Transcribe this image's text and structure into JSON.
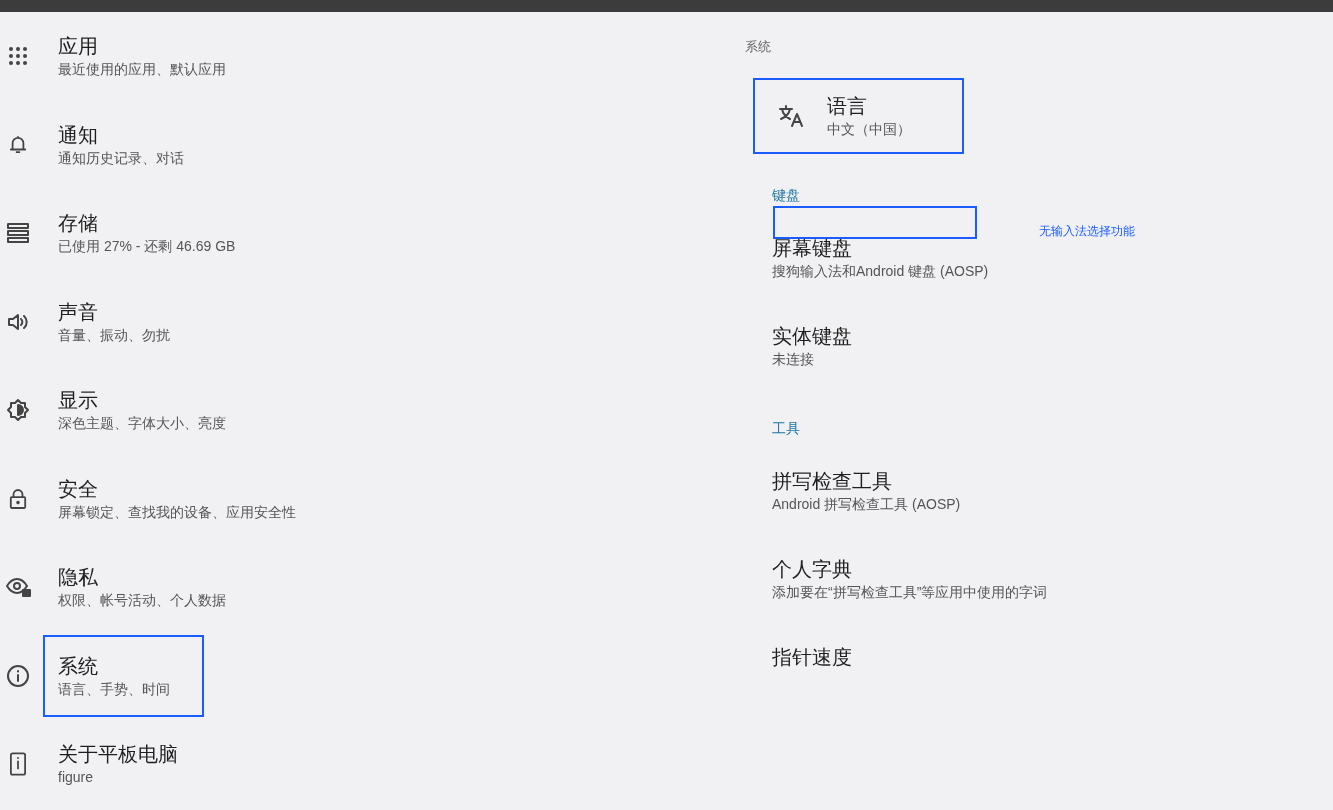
{
  "sidebar": {
    "items": [
      {
        "title": "应用",
        "subtitle": "最近使用的应用、默认应用",
        "highlighted": false
      },
      {
        "title": "通知",
        "subtitle": "通知历史记录、对话",
        "highlighted": false
      },
      {
        "title": "存储",
        "subtitle": "已使用 27% - 还剩 46.69 GB",
        "highlighted": false
      },
      {
        "title": "声音",
        "subtitle": "音量、振动、勿扰",
        "highlighted": false
      },
      {
        "title": "显示",
        "subtitle": "深色主题、字体大小、亮度",
        "highlighted": false
      },
      {
        "title": "安全",
        "subtitle": "屏幕锁定、查找我的设备、应用安全性",
        "highlighted": false
      },
      {
        "title": "隐私",
        "subtitle": "权限、帐号活动、个人数据",
        "highlighted": false
      },
      {
        "title": "系统",
        "subtitle": "语言、手势、时间",
        "highlighted": true
      },
      {
        "title": "关于平板电脑",
        "subtitle": "figure",
        "highlighted": false
      }
    ]
  },
  "panel": {
    "title": "系统",
    "sections": [
      {
        "items": [
          {
            "title": "语言",
            "subtitle": "中文（中国）",
            "highlighted": true
          }
        ]
      },
      {
        "heading": "键盘",
        "items": [
          {
            "title": "屏幕键盘",
            "subtitle": "搜狗输入法和Android 键盘 (AOSP)",
            "highlighted": false
          },
          {
            "title": "实体键盘",
            "subtitle": "未连接",
            "highlighted": false
          }
        ]
      },
      {
        "heading": "工具",
        "items": [
          {
            "title": "拼写检查工具",
            "subtitle": "Android 拼写检查工具 (AOSP)",
            "highlighted": false
          },
          {
            "title": "个人字典",
            "subtitle": "添加要在“拼写检查工具”等应用中使用的字词",
            "highlighted": false
          },
          {
            "title": "指针速度",
            "highlighted": false
          }
        ]
      }
    ]
  },
  "annotations": [
    {
      "kind": "box"
    },
    {
      "kind": "note",
      "text": "无输入法选择功能"
    }
  ]
}
